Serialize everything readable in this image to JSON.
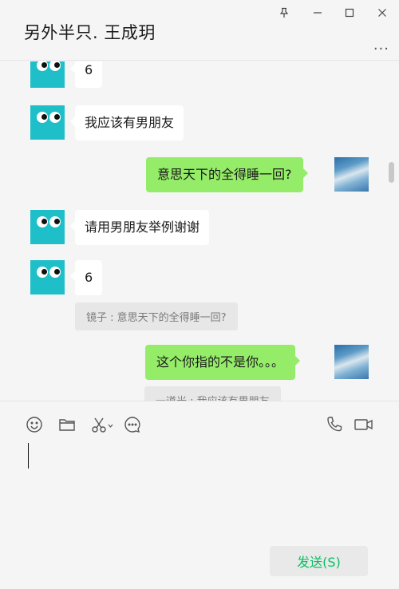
{
  "window": {
    "title": "另外半只. 王成玥",
    "pin_icon": "pin-icon",
    "minimize_icon": "minimize-icon",
    "maximize_icon": "maximize-icon",
    "close_icon": "close-icon",
    "more_label": "..."
  },
  "messages": [
    {
      "side": "in",
      "text": "6"
    },
    {
      "side": "in",
      "text": "我应该有男朋友"
    },
    {
      "side": "out",
      "text": "意思天下的全得睡一回?"
    },
    {
      "side": "in",
      "text": "请用男朋友举例谢谢"
    },
    {
      "side": "in",
      "text": "6",
      "quote": "镜子 : 意思天下的全得睡一回?"
    },
    {
      "side": "out",
      "text": "这个你指的不是你。。。",
      "quote": "一道光 : 我应该有男朋友"
    }
  ],
  "toolbar": {
    "icons": [
      "emoji-icon",
      "folder-icon",
      "scissors-icon",
      "chat-history-icon",
      "phone-icon",
      "video-icon"
    ],
    "scissors_dropdown": "▾"
  },
  "input": {
    "value": ""
  },
  "send_button": {
    "label": "发送(S)"
  },
  "colors": {
    "accent": "#07c160",
    "out_bubble": "#95ec69",
    "in_bubble": "#ffffff",
    "bot_avatar": "#1fbfca"
  }
}
